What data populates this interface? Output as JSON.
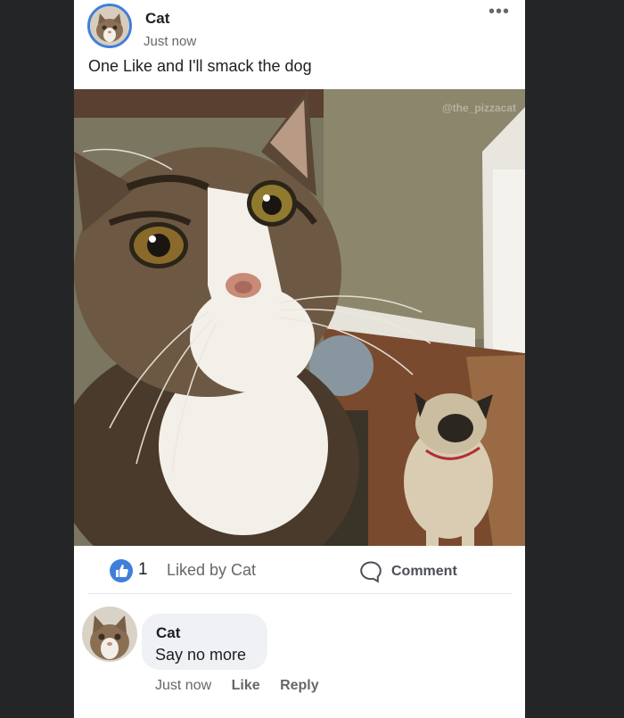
{
  "post": {
    "author": "Cat",
    "time": "Just now",
    "caption": "One Like and I'll smack the dog",
    "more_icon": "more-dots-icon",
    "watermark": "@the_pizzacat"
  },
  "reactions": {
    "like_icon": "thumbs-up-icon",
    "count": "1",
    "liked_by": "Liked by Cat",
    "comment_label": "Comment",
    "comment_icon": "speech-bubble-icon",
    "accent": "#3f7fd9"
  },
  "comment": {
    "author": "Cat",
    "text": "Say no more",
    "time": "Just now",
    "like_label": "Like",
    "reply_label": "Reply"
  }
}
